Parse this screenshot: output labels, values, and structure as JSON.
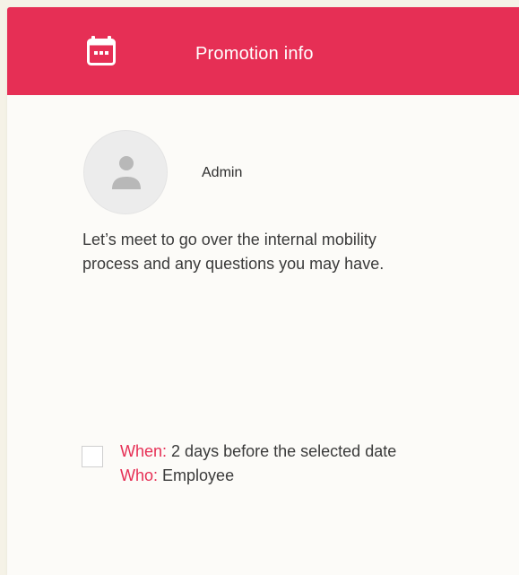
{
  "header": {
    "title": "Promotion info",
    "icon": "calendar-icon",
    "color": "#e62f55"
  },
  "post": {
    "author": "Admin",
    "avatar_icon": "user-icon",
    "message": "Let’s meet to go over the internal mobility process and any questions you may have."
  },
  "reminder": {
    "checked": false,
    "when_label": "When:",
    "when_value": "2 days before the selected date",
    "who_label": "Who:",
    "who_value": "Employee"
  }
}
